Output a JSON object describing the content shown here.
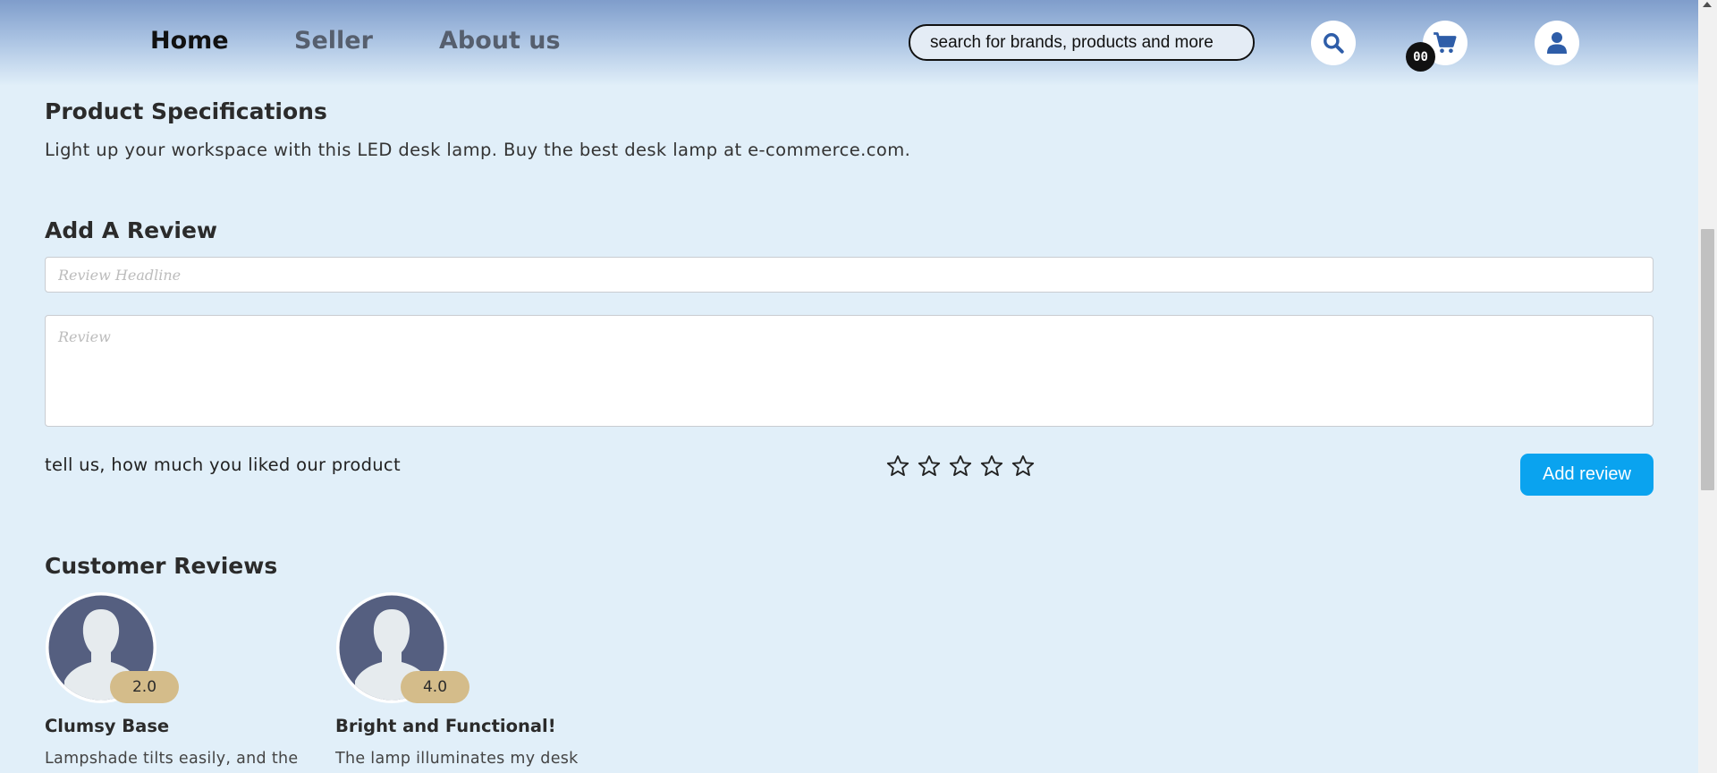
{
  "header": {
    "nav": [
      {
        "label": "Home"
      },
      {
        "label": "Seller"
      },
      {
        "label": "About us"
      }
    ],
    "search": {
      "placeholder": "search for brands, products and more",
      "icon": "search-icon"
    },
    "cart": {
      "count": "00",
      "icon": "cart-icon"
    },
    "user": {
      "icon": "user-icon"
    }
  },
  "specifications": {
    "title": "Product Specifications",
    "text": "Light up your workspace with this LED desk lamp. Buy the best desk lamp at e-commerce.com."
  },
  "add_review": {
    "title": "Add A Review",
    "headline_placeholder": "Review Headline",
    "review_placeholder": "Review",
    "rating_prompt": "tell us, how much you liked our product",
    "stars": 5,
    "button_label": "Add review"
  },
  "customer_reviews": {
    "title": "Customer Reviews",
    "items": [
      {
        "rating": "2.0",
        "headline": "Clumsy Base",
        "body": "Lampshade tilts easily, and the"
      },
      {
        "rating": "4.0",
        "headline": "Bright and Functional!",
        "body": "The lamp illuminates my desk"
      }
    ]
  },
  "colors": {
    "page_bg": "#e1eff9",
    "accent_button": "#0aa3ef",
    "icon_blue": "#2e5da8",
    "rating_badge": "#d4bc8a",
    "avatar_bg": "#555f80"
  }
}
